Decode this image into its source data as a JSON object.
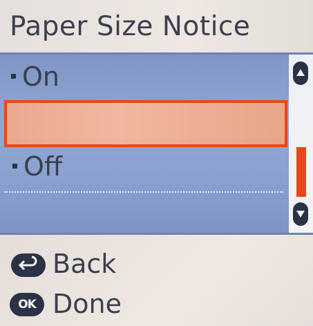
{
  "title": "Paper Size Notice",
  "options": [
    {
      "label": "On",
      "selected": false
    },
    {
      "label": "Off",
      "selected": true
    }
  ],
  "scrollbar": {
    "up_icon": "triangle-up-icon",
    "down_icon": "triangle-down-icon"
  },
  "footer": {
    "back": {
      "label": "Back",
      "icon": "back-arrow-icon"
    },
    "done": {
      "label": "Done",
      "icon": "ok-icon",
      "icon_text": "OK"
    }
  },
  "colors": {
    "accent": "#e9461c",
    "list_bg": "#8aa0cf",
    "text": "#3a3f4f"
  }
}
